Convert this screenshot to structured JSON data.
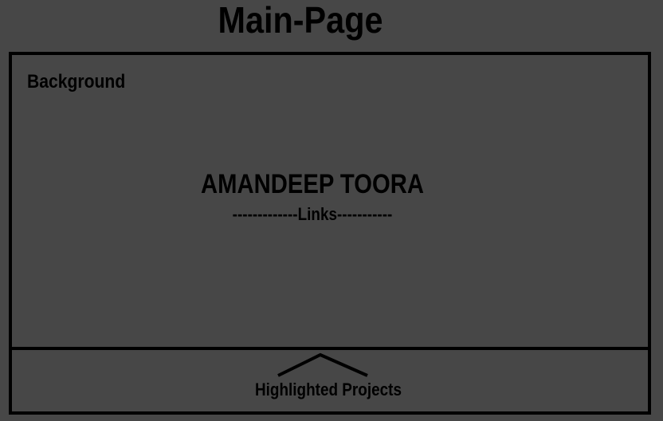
{
  "page": {
    "title": "Main-Page"
  },
  "frame": {
    "background_label": "Background",
    "name": "AMANDEEP TOORA",
    "links_line": "-------------Links-----------",
    "footer_label": "Highlighted Projects"
  },
  "colors": {
    "background": "#474747",
    "ink": "#000000"
  },
  "icons": {
    "footer_arrow": "caret-up-icon"
  }
}
